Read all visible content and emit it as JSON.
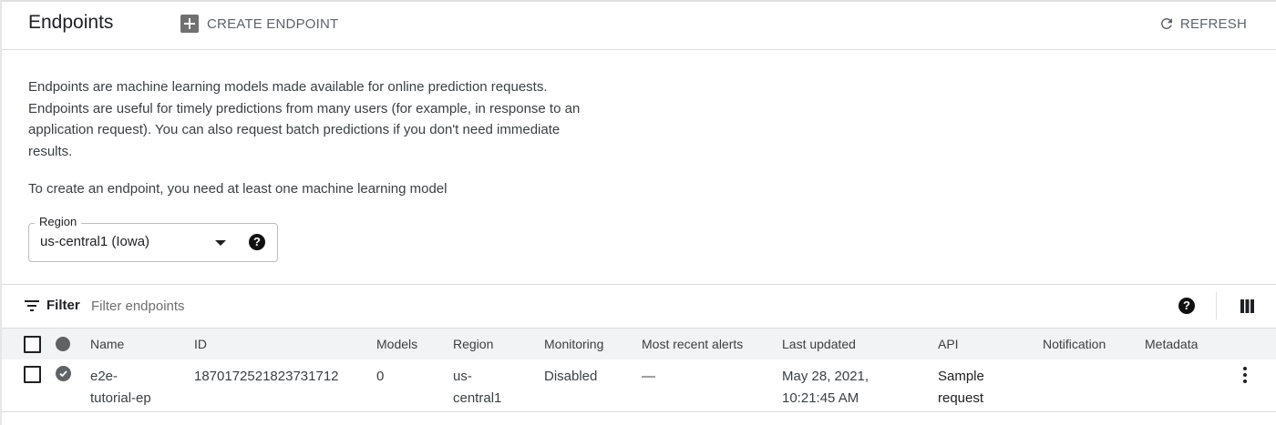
{
  "header": {
    "title": "Endpoints",
    "create_label": "CREATE ENDPOINT",
    "refresh_label": "REFRESH"
  },
  "description": {
    "paragraph1": "Endpoints are machine learning models made available for online prediction requests. Endpoints are useful for timely predictions from many users (for example, in response to an application request). You can also request batch predictions if you don't need immediate results.",
    "paragraph2": "To create an endpoint, you need at least one machine learning model"
  },
  "region": {
    "label": "Region",
    "value": "us-central1 (Iowa)",
    "help_glyph": "?"
  },
  "filter": {
    "label": "Filter",
    "placeholder": "Filter endpoints",
    "help_glyph": "?"
  },
  "table": {
    "columns": [
      "Name",
      "ID",
      "Models",
      "Region",
      "Monitoring",
      "Most recent alerts",
      "Last updated",
      "API",
      "Notification",
      "Metadata"
    ],
    "rows": [
      {
        "name": "e2e-tutorial-ep",
        "id": "1870172521823731712",
        "models": "0",
        "region": "us-central1",
        "monitoring": "Disabled",
        "alerts": "—",
        "last_updated": "May 28, 2021, 10:21:45 AM",
        "api": "Sample request",
        "notification": "",
        "metadata": ""
      }
    ]
  },
  "icons": {
    "create": "plus-box-icon",
    "refresh": "refresh-icon",
    "dropdown": "dropdown-arrow-icon",
    "help": "help-icon",
    "filter": "filter-icon",
    "columns": "column-display-icon",
    "status": "check-circle-icon",
    "more": "more-vert-icon"
  },
  "colors": {
    "text": "#202124",
    "secondary_text": "#5f6368",
    "header_bg": "#f1f3f4",
    "border": "#dadce0",
    "status_icon": "#5f6368"
  }
}
